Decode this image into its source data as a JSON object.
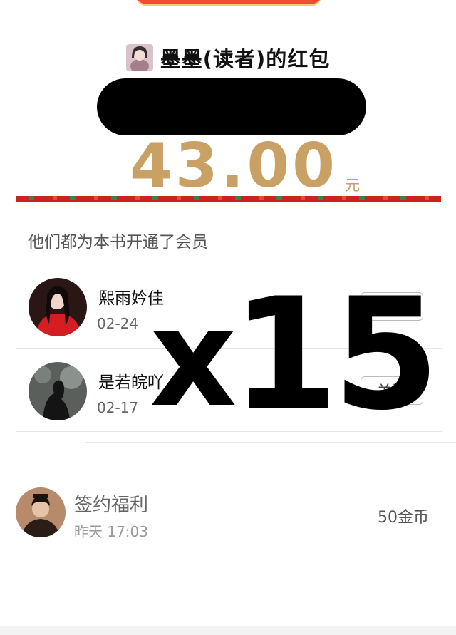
{
  "header": {
    "title": "墨墨(读者)的红包"
  },
  "red_packet": {
    "amount": "43.00",
    "unit": "元"
  },
  "members_section": {
    "title": "他们都为本书开通了会员",
    "members": [
      {
        "name": "熙雨妗佳",
        "date": "02-24",
        "button": "关注"
      },
      {
        "name": "是若皖吖",
        "date": "02-17",
        "button": "关注"
      }
    ]
  },
  "overlay_text": {
    "prefix": "x",
    "count": "15"
  },
  "welfare": {
    "title": "签约福利",
    "time": "昨天 17:03",
    "reward": "50金币"
  },
  "colors": {
    "amount_gold": "#c9a165",
    "festive_red": "#d51e1c"
  }
}
